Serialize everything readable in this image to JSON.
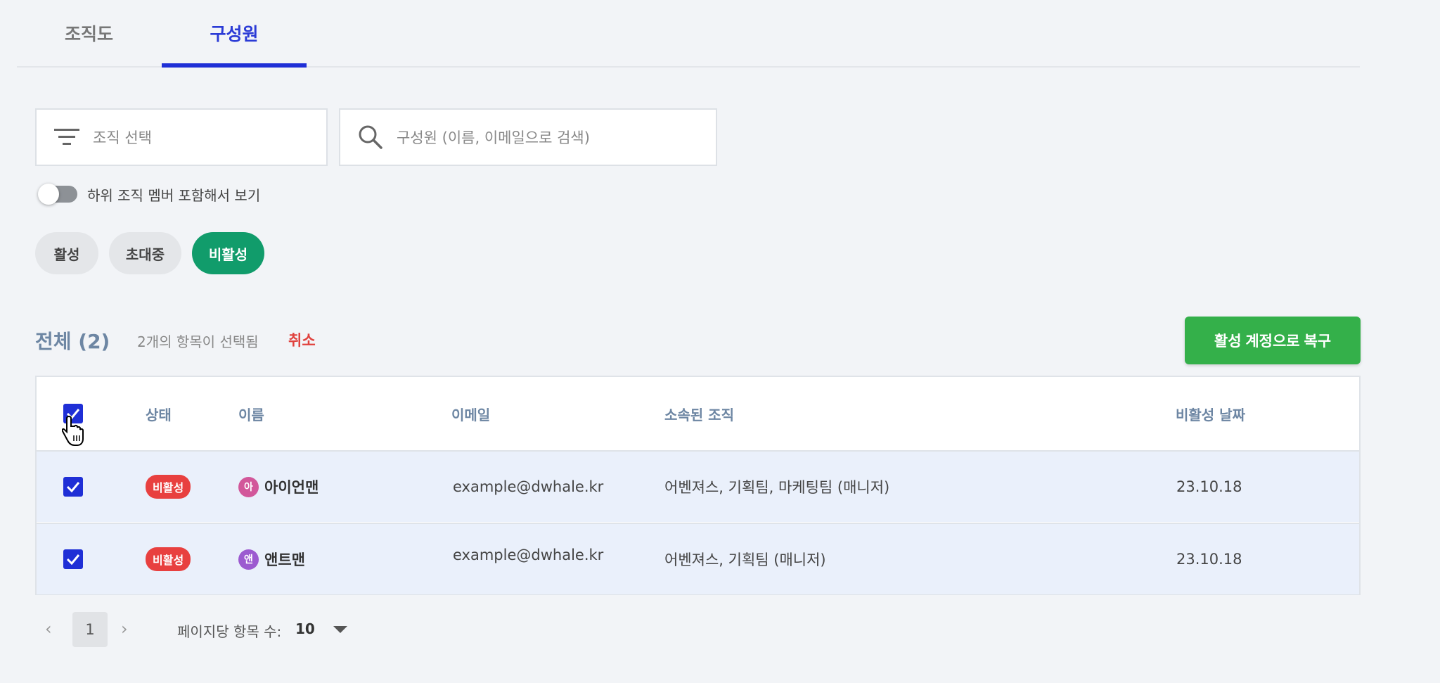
{
  "tabs": [
    {
      "label": "조직도"
    },
    {
      "label": "구성원"
    }
  ],
  "filter": {
    "placeholder": "조직 선택",
    "icon": "filter-icon"
  },
  "search": {
    "placeholder": "구성원 (이름, 이메일으로 검색)",
    "icon": "search-icon"
  },
  "toggle": {
    "label": "하위 조직 멤버 포함해서 보기",
    "on": false
  },
  "chips": [
    {
      "label": "활성",
      "selected": false
    },
    {
      "label": "초대중",
      "selected": false
    },
    {
      "label": "비활성",
      "selected": true
    }
  ],
  "list_header": {
    "total": "전체 (2)",
    "selected_text": "2개의 항목이 선택됨",
    "cancel": "취소",
    "restore_button": "활성 계정으로 복구"
  },
  "table": {
    "columns": [
      "상태",
      "이름",
      "이메일",
      "소속된 조직",
      "비활성 날짜"
    ],
    "rows": [
      {
        "checked": true,
        "status": "비활성",
        "avatar": "아",
        "avatar_color": "#d2579a",
        "name": "아이언맨",
        "email": "example@dwhale.kr",
        "org": "어벤져스, 기획팀, 마케팅팀 (매니저)",
        "date": "23.10.18"
      },
      {
        "checked": true,
        "status": "비활성",
        "avatar": "앤",
        "avatar_color": "#9c5ad0",
        "name": "앤트맨",
        "email": "example@dwhale.kr",
        "org": "어벤져스, 기획팀 (매니저)",
        "date": "23.10.18"
      }
    ]
  },
  "pagination": {
    "page": "1",
    "per_page_label": "페이지당 항목 수:",
    "per_page_value": "10"
  },
  "colors": {
    "accent": "#1f2fd6",
    "chip_active": "#119c6b",
    "restore_button": "#34b04a",
    "status_badge": "#e8403f",
    "cancel": "#e0413d"
  }
}
